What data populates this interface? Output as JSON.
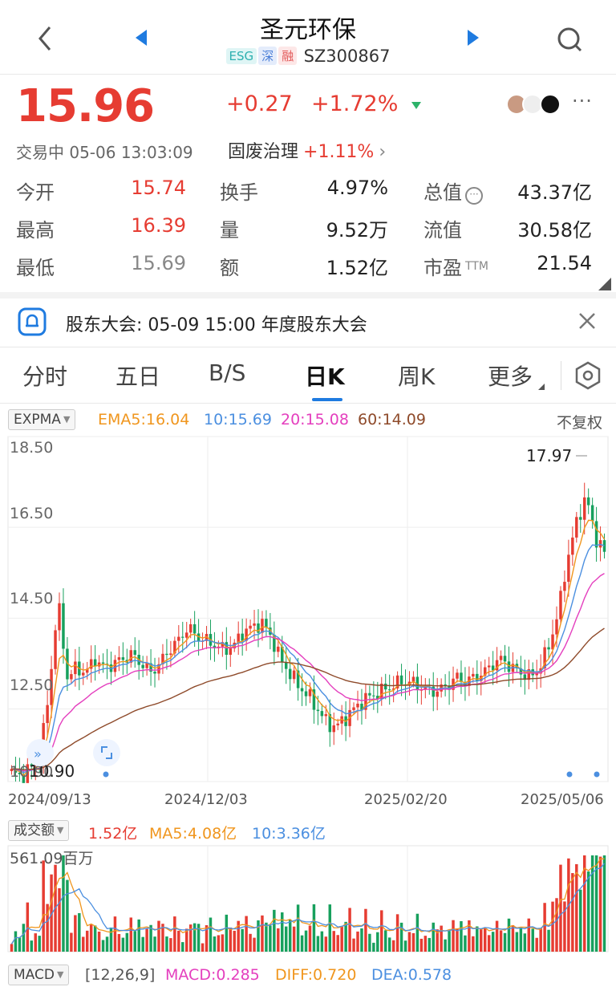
{
  "header": {
    "title": "圣元环保",
    "tags": [
      "ESG",
      "深",
      "融"
    ],
    "code": "SZ300867"
  },
  "quote": {
    "price": "15.96",
    "change": "+0.27",
    "change_pct": "+1.72%",
    "status": "交易中 05-06 13:03:09",
    "sector": "固废治理",
    "sector_pct": "+1.11%"
  },
  "stats": [
    {
      "label": "今开",
      "value": "15.74",
      "color": "red"
    },
    {
      "label": "换手",
      "value": "4.97%",
      "color": "normal"
    },
    {
      "label": "总值",
      "value": "43.37亿",
      "color": "normal"
    },
    {
      "label": "最高",
      "value": "16.39",
      "color": "red"
    },
    {
      "label": "量",
      "value": "9.52万",
      "color": "normal"
    },
    {
      "label": "流值",
      "value": "30.58亿",
      "color": "normal"
    },
    {
      "label": "最低",
      "value": "15.69",
      "color": "gray"
    },
    {
      "label": "额",
      "value": "1.52亿",
      "color": "normal"
    },
    {
      "label": "市盈",
      "value": "21.54",
      "color": "normal",
      "suffix": "TTM"
    }
  ],
  "notice": {
    "text": "股东大会: 05-09 15:00 年度股东大会"
  },
  "tabs": [
    "分时",
    "五日",
    "B/S",
    "日K",
    "周K",
    "更多"
  ],
  "active_tab": "日K",
  "kline": {
    "indicator": "EXPMA",
    "ema5": "EMA5:16.04",
    "ema10": "10:15.69",
    "ema20": "20:15.08",
    "ema60": "60:14.09",
    "adjust": "不复权",
    "ymax_label": "18.50",
    "high_label": "17.97",
    "low_label": "10.90",
    "date_labels": [
      "2024/09/13",
      "2024/12/03",
      "2025/02/20",
      "2025/05/06"
    ]
  },
  "volume": {
    "indicator": "成交额",
    "value": "1.52亿",
    "ma5": "MA5:4.08亿",
    "ma10": "10:3.36亿",
    "max_label": "561.09百万"
  },
  "macd": {
    "indicator": "MACD",
    "params": "[12,26,9]",
    "macd": "MACD:0.285",
    "diff": "DIFF:0.720",
    "dea": "DEA:0.578"
  },
  "chart_data": {
    "type": "candlestick",
    "title": "",
    "x_range": [
      "2024/09/13",
      "2025/05/06"
    ],
    "ylim": [
      10.9,
      18.5
    ],
    "y_ticks": [
      18.5,
      16.5,
      14.5,
      12.5,
      10.9
    ],
    "last_close": 15.96,
    "period_high": 17.97,
    "period_low": 10.9,
    "close_series": [
      11.1,
      11.0,
      11.2,
      11.4,
      12.8,
      14.9,
      13.2,
      13.4,
      13.3,
      13.6,
      13.4,
      13.5,
      13.6,
      13.7,
      13.5,
      13.3,
      13.5,
      13.8,
      14.0,
      14.3,
      14.1,
      14.0,
      13.9,
      13.8,
      13.9,
      14.2,
      14.3,
      14.4,
      14.1,
      13.6,
      13.3,
      13.0,
      12.8,
      12.5,
      12.2,
      12.1,
      12.3,
      12.5,
      12.7,
      12.8,
      12.9,
      13.0,
      13.1,
      13.1,
      13.0,
      12.9,
      12.9,
      13.0,
      13.2,
      13.1,
      13.2,
      13.3,
      13.5,
      13.6,
      13.4,
      13.3,
      13.2,
      13.4,
      13.9,
      14.6,
      15.8,
      16.6,
      17.2,
      16.3,
      15.96
    ]
  }
}
